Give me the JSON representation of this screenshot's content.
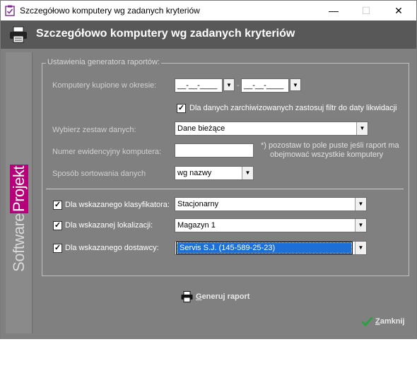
{
  "window": {
    "title": "Szczegółowo komputery wg zadanych kryteriów",
    "minimize_icon": "minimize-icon",
    "maximize_icon": "maximize-icon",
    "close_icon": "close-icon"
  },
  "header": {
    "title": "Szczegółowo komputery wg zadanych kryteriów"
  },
  "brand": {
    "part1": "Software",
    "part2": "Projekt",
    "accent": "#b5007a"
  },
  "settings": {
    "legend": "Ustawienia generatora raportów:",
    "period_label": "Komputery kupione w okresie:",
    "date_from": "__-__-____",
    "date_sep": "-",
    "date_to": "__-__-____",
    "archive_filter_label": "Dla danych zarchiwizowanych zastosuj filtr do daty likwidacji",
    "archive_filter_checked": true,
    "dataset_label": "Wybierz zestaw danych:",
    "dataset_value": "Dane bieżące",
    "inventory_label": "Numer ewidencyjny komputera:",
    "inventory_value": "",
    "inventory_hint_1": "*) pozostaw to pole puste jeśli raport ma",
    "inventory_hint_2": "obejmować wszystkie komputery",
    "sort_label": "Sposób sortowania danych",
    "sort_value": "wg nazwy"
  },
  "filters": {
    "classifier_label": "Dla wskazanego klasyfikatora:",
    "classifier_checked": true,
    "classifier_value": "Stacjonarny",
    "location_label": "Dla wskazanej lokalizacji:",
    "location_checked": true,
    "location_value": "Magazyn 1",
    "supplier_label": "Dla wskazanego dostawcy:",
    "supplier_checked": true,
    "supplier_value": "Servis S.J. (145-589-25-23)"
  },
  "actions": {
    "generate_accel": "G",
    "generate_rest": "eneruj raport",
    "close_accel": "Z",
    "close_rest": "amknij"
  },
  "colors": {
    "accent_green": "#2ea043",
    "selection": "#1c6fd6"
  }
}
